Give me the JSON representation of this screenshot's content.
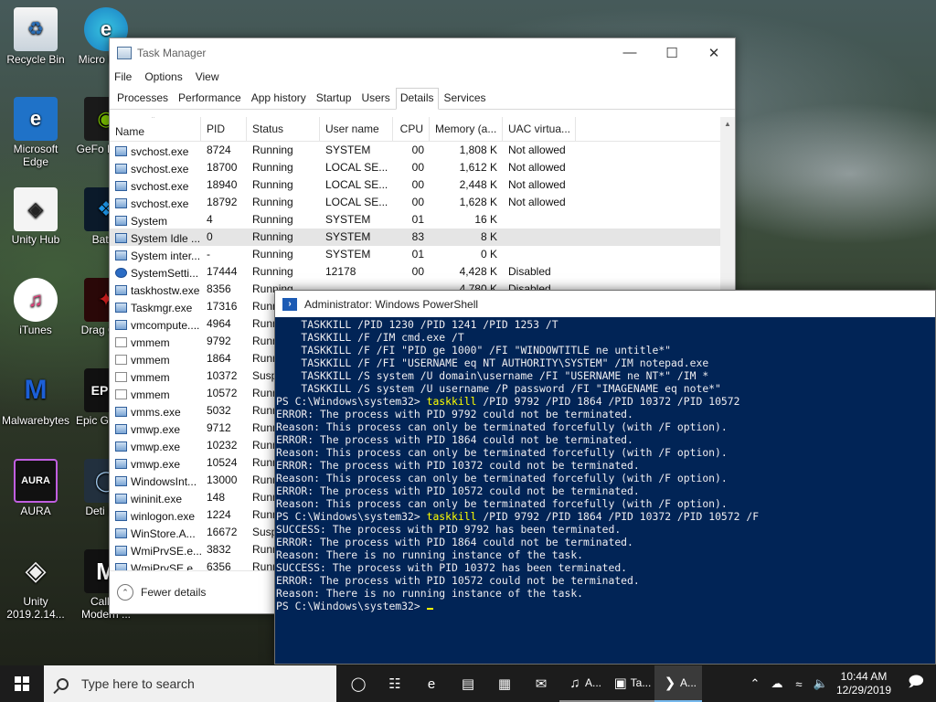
{
  "desktop": {
    "icons": [
      {
        "label": "Recycle Bin",
        "icon": "recycle-bin-icon"
      },
      {
        "label": "Microsoft Edge",
        "icon": "edge-icon"
      },
      {
        "label": "Unity Hub",
        "icon": "unity-hub-icon"
      },
      {
        "label": "iTunes",
        "icon": "itunes-icon"
      },
      {
        "label": "Malwarebytes",
        "icon": "malwarebytes-icon"
      },
      {
        "label": "AURA",
        "icon": "aura-icon"
      },
      {
        "label": "Unity 2019.2.14...",
        "icon": "unity-icon"
      },
      {
        "label": "Micro Edge",
        "icon": "edge-icon"
      },
      {
        "label": "GeFo Exper",
        "icon": "geforce-icon"
      },
      {
        "label": "Battle",
        "icon": "battlenet-icon"
      },
      {
        "label": "Drag Cent",
        "icon": "dragon-center-icon"
      },
      {
        "label": "Epic G Laun",
        "icon": "epic-games-icon"
      },
      {
        "label": "Deti Bec",
        "icon": "detroit-icon"
      },
      {
        "label": "Call of Modern ...",
        "icon": "call-of-duty-icon"
      }
    ]
  },
  "taskmgr": {
    "title": "Task Manager",
    "menu": [
      "File",
      "Options",
      "View"
    ],
    "tabs": [
      "Processes",
      "Performance",
      "App history",
      "Startup",
      "Users",
      "Details",
      "Services"
    ],
    "active_tab": "Details",
    "columns": [
      "Name",
      "PID",
      "Status",
      "User name",
      "CPU",
      "Memory (a...",
      "UAC virtua..."
    ],
    "rows": [
      {
        "name": "svchost.exe",
        "pid": "8724",
        "status": "Running",
        "user": "SYSTEM",
        "cpu": "00",
        "mem": "1,808 K",
        "uac": "Not allowed"
      },
      {
        "name": "svchost.exe",
        "pid": "18700",
        "status": "Running",
        "user": "LOCAL SE...",
        "cpu": "00",
        "mem": "1,612 K",
        "uac": "Not allowed"
      },
      {
        "name": "svchost.exe",
        "pid": "18940",
        "status": "Running",
        "user": "LOCAL SE...",
        "cpu": "00",
        "mem": "2,448 K",
        "uac": "Not allowed"
      },
      {
        "name": "svchost.exe",
        "pid": "18792",
        "status": "Running",
        "user": "LOCAL SE...",
        "cpu": "00",
        "mem": "1,628 K",
        "uac": "Not allowed"
      },
      {
        "name": "System",
        "pid": "4",
        "status": "Running",
        "user": "SYSTEM",
        "cpu": "01",
        "mem": "16 K",
        "uac": ""
      },
      {
        "name": "System Idle ...",
        "pid": "0",
        "status": "Running",
        "user": "SYSTEM",
        "cpu": "83",
        "mem": "8 K",
        "uac": "",
        "selected": true
      },
      {
        "name": "System inter...",
        "pid": "-",
        "status": "Running",
        "user": "SYSTEM",
        "cpu": "01",
        "mem": "0 K",
        "uac": ""
      },
      {
        "name": "SystemSetti...",
        "pid": "17444",
        "status": "Running",
        "user": "12178",
        "cpu": "00",
        "mem": "4,428 K",
        "uac": "Disabled"
      },
      {
        "name": "taskhostw.exe",
        "pid": "8356",
        "status": "Running",
        "user": "",
        "cpu": "",
        "mem": "4,780 K",
        "uac": "Disabled"
      },
      {
        "name": "Taskmgr.exe",
        "pid": "17316",
        "status": "Runn",
        "user": "",
        "cpu": "",
        "mem": "",
        "uac": ""
      },
      {
        "name": "vmcompute....",
        "pid": "4964",
        "status": "Runn",
        "user": "",
        "cpu": "",
        "mem": "",
        "uac": ""
      },
      {
        "name": "vmmem",
        "pid": "9792",
        "status": "Runn",
        "user": "",
        "cpu": "",
        "mem": "",
        "uac": ""
      },
      {
        "name": "vmmem",
        "pid": "1864",
        "status": "Runn",
        "user": "",
        "cpu": "",
        "mem": "",
        "uac": ""
      },
      {
        "name": "vmmem",
        "pid": "10372",
        "status": "Susp",
        "user": "",
        "cpu": "",
        "mem": "",
        "uac": ""
      },
      {
        "name": "vmmem",
        "pid": "10572",
        "status": "Runn",
        "user": "",
        "cpu": "",
        "mem": "",
        "uac": ""
      },
      {
        "name": "vmms.exe",
        "pid": "5032",
        "status": "Runn",
        "user": "",
        "cpu": "",
        "mem": "",
        "uac": ""
      },
      {
        "name": "vmwp.exe",
        "pid": "9712",
        "status": "Runn",
        "user": "",
        "cpu": "",
        "mem": "",
        "uac": ""
      },
      {
        "name": "vmwp.exe",
        "pid": "10232",
        "status": "Runn",
        "user": "",
        "cpu": "",
        "mem": "",
        "uac": ""
      },
      {
        "name": "vmwp.exe",
        "pid": "10524",
        "status": "Runn",
        "user": "",
        "cpu": "",
        "mem": "",
        "uac": ""
      },
      {
        "name": "WindowsInt...",
        "pid": "13000",
        "status": "Runn",
        "user": "",
        "cpu": "",
        "mem": "",
        "uac": ""
      },
      {
        "name": "wininit.exe",
        "pid": "148",
        "status": "Runn",
        "user": "",
        "cpu": "",
        "mem": "",
        "uac": ""
      },
      {
        "name": "winlogon.exe",
        "pid": "1224",
        "status": "Runn",
        "user": "",
        "cpu": "",
        "mem": "",
        "uac": ""
      },
      {
        "name": "WinStore.A...",
        "pid": "16672",
        "status": "Susp",
        "user": "",
        "cpu": "",
        "mem": "",
        "uac": ""
      },
      {
        "name": "WmiPrvSE.e...",
        "pid": "3832",
        "status": "Runn",
        "user": "",
        "cpu": "",
        "mem": "",
        "uac": ""
      },
      {
        "name": "WmiPrvSE.e...",
        "pid": "6356",
        "status": "Runn",
        "user": "",
        "cpu": "",
        "mem": "",
        "uac": ""
      }
    ],
    "fewer_details": "Fewer details"
  },
  "powershell": {
    "title": "Administrator: Windows PowerShell",
    "lines": [
      {
        "text": "    TASKKILL /PID 1230 /PID 1241 /PID 1253 /T"
      },
      {
        "text": "    TASKKILL /F /IM cmd.exe /T"
      },
      {
        "text": "    TASKKILL /F /FI \"PID ge 1000\" /FI \"WINDOWTITLE ne untitle*\""
      },
      {
        "text": "    TASKKILL /F /FI \"USERNAME eq NT AUTHORITY\\SYSTEM\" /IM notepad.exe"
      },
      {
        "text": "    TASKKILL /S system /U domain\\username /FI \"USERNAME ne NT*\" /IM *"
      },
      {
        "text": "    TASKKILL /S system /U username /P password /FI \"IMAGENAME eq note*\""
      },
      {
        "prompt": "PS C:\\Windows\\system32> ",
        "cmd": "taskkill",
        "args": " /PID 9792 /PID 1864 /PID 10372 /PID 10572"
      },
      {
        "text": "ERROR: The process with PID 9792 could not be terminated."
      },
      {
        "text": "Reason: This process can only be terminated forcefully (with /F option)."
      },
      {
        "text": "ERROR: The process with PID 1864 could not be terminated."
      },
      {
        "text": "Reason: This process can only be terminated forcefully (with /F option)."
      },
      {
        "text": "ERROR: The process with PID 10372 could not be terminated."
      },
      {
        "text": "Reason: This process can only be terminated forcefully (with /F option)."
      },
      {
        "text": "ERROR: The process with PID 10572 could not be terminated."
      },
      {
        "text": "Reason: This process can only be terminated forcefully (with /F option)."
      },
      {
        "prompt": "PS C:\\Windows\\system32> ",
        "cmd": "taskkill",
        "args": " /PID 9792 /PID 1864 /PID 10372 /PID 10572 /F"
      },
      {
        "text": "SUCCESS: The process with PID 9792 has been terminated."
      },
      {
        "text": "ERROR: The process with PID 1864 could not be terminated."
      },
      {
        "text": "Reason: There is no running instance of the task."
      },
      {
        "text": "SUCCESS: The process with PID 10372 has been terminated."
      },
      {
        "text": "ERROR: The process with PID 10572 could not be terminated."
      },
      {
        "text": "Reason: There is no running instance of the task."
      },
      {
        "prompt": "PS C:\\Windows\\system32> ",
        "cursor": true
      }
    ]
  },
  "taskbar": {
    "search_placeholder": "Type here to search",
    "items": [
      {
        "name": "task-view-icon",
        "glyph": "◯"
      },
      {
        "name": "timeline-icon",
        "glyph": "☷"
      },
      {
        "name": "edge-icon",
        "glyph": "e"
      },
      {
        "name": "file-explorer-icon",
        "glyph": "▤"
      },
      {
        "name": "store-icon",
        "glyph": "▦"
      },
      {
        "name": "mail-icon",
        "glyph": "✉"
      },
      {
        "name": "itunes-taskbar",
        "glyph": "♫",
        "label": "A...",
        "open": true
      },
      {
        "name": "taskmgr-taskbar",
        "glyph": "▣",
        "label": "Ta...",
        "open": true
      },
      {
        "name": "powershell-taskbar",
        "glyph": "❯",
        "label": "A...",
        "active": true
      }
    ],
    "time": "10:44 AM",
    "date": "12/29/2019"
  },
  "colors": {
    "powershell_bg": "#012456",
    "powershell_cmd": "#ffff00",
    "taskbar_bg": "#1c1c1c",
    "active_indicator": "#76b9ed"
  }
}
